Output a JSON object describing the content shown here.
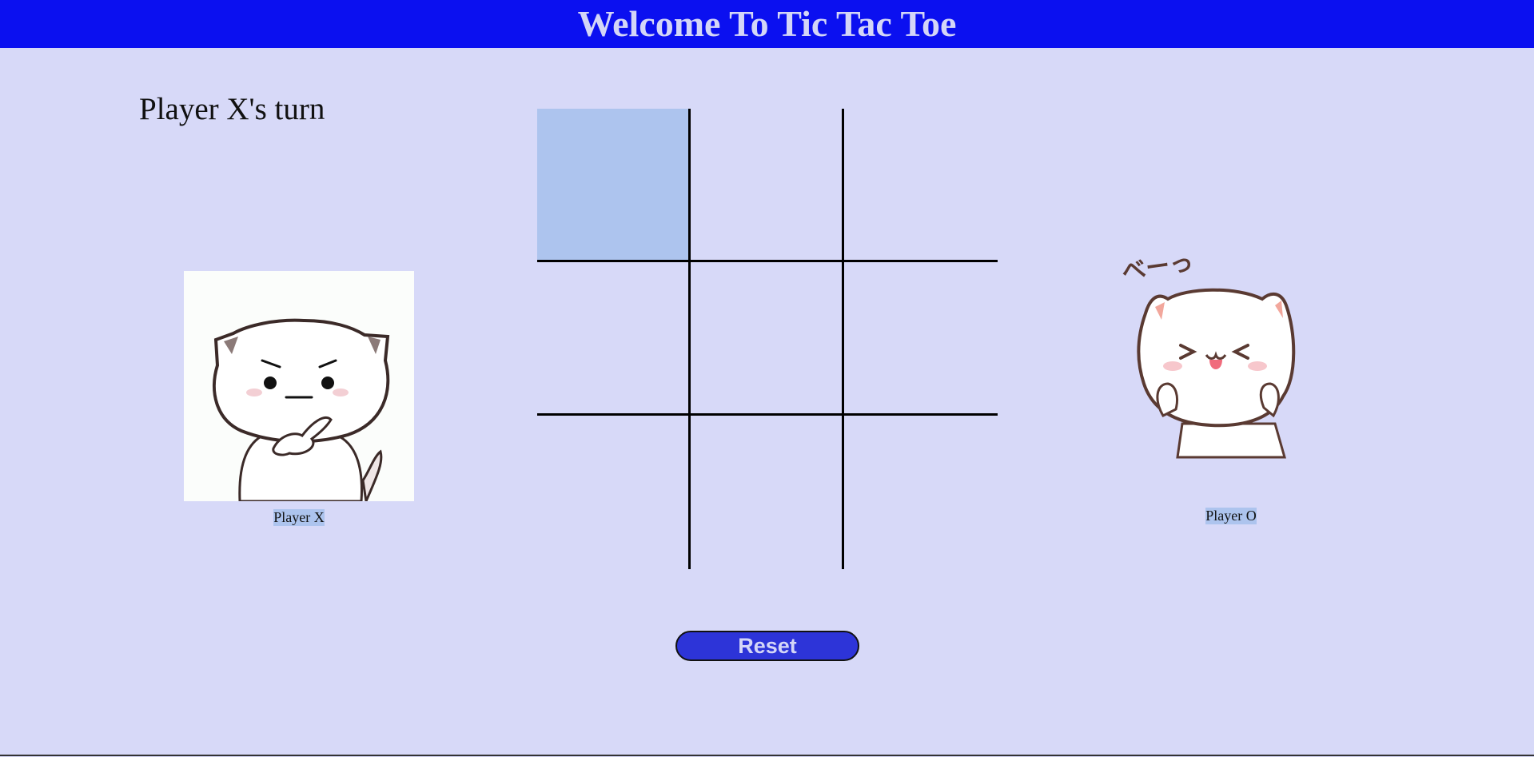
{
  "header": {
    "title": "Welcome To Tic Tac Toe"
  },
  "status": {
    "text": "Player X's turn"
  },
  "board": {
    "cells": [
      "",
      "",
      "",
      "",
      "",
      "",
      "",
      "",
      ""
    ],
    "highlighted_cell": 0
  },
  "players": {
    "x": {
      "label": "Player X",
      "avatar": "cat-thinking-avatar"
    },
    "o": {
      "label": "Player O",
      "avatar": "cat-tongue-out-avatar",
      "caption": "べーっ"
    }
  },
  "controls": {
    "reset_label": "Reset"
  },
  "colors": {
    "header_bg": "#0b10f0",
    "page_bg": "#d7d9f8",
    "highlight": "#adc4ee",
    "button_bg": "#2d34d8",
    "title_text": "#d4d6f7"
  }
}
